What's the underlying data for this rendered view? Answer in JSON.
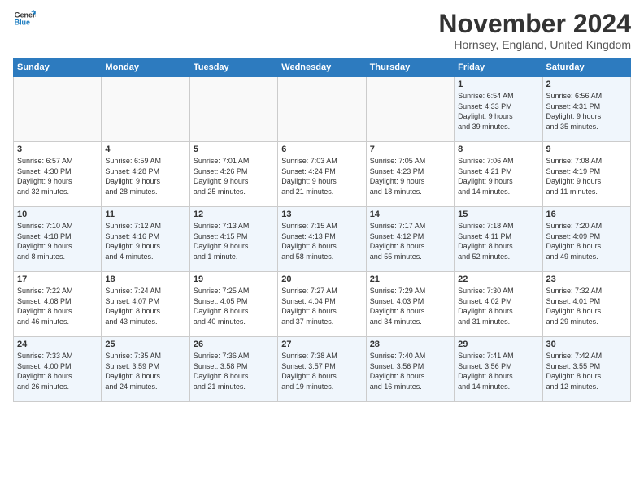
{
  "logo": {
    "text_general": "General",
    "text_blue": "Blue"
  },
  "title": "November 2024",
  "location": "Hornsey, England, United Kingdom",
  "headers": [
    "Sunday",
    "Monday",
    "Tuesday",
    "Wednesday",
    "Thursday",
    "Friday",
    "Saturday"
  ],
  "weeks": [
    [
      {
        "day": "",
        "info": ""
      },
      {
        "day": "",
        "info": ""
      },
      {
        "day": "",
        "info": ""
      },
      {
        "day": "",
        "info": ""
      },
      {
        "day": "",
        "info": ""
      },
      {
        "day": "1",
        "info": "Sunrise: 6:54 AM\nSunset: 4:33 PM\nDaylight: 9 hours\nand 39 minutes."
      },
      {
        "day": "2",
        "info": "Sunrise: 6:56 AM\nSunset: 4:31 PM\nDaylight: 9 hours\nand 35 minutes."
      }
    ],
    [
      {
        "day": "3",
        "info": "Sunrise: 6:57 AM\nSunset: 4:30 PM\nDaylight: 9 hours\nand 32 minutes."
      },
      {
        "day": "4",
        "info": "Sunrise: 6:59 AM\nSunset: 4:28 PM\nDaylight: 9 hours\nand 28 minutes."
      },
      {
        "day": "5",
        "info": "Sunrise: 7:01 AM\nSunset: 4:26 PM\nDaylight: 9 hours\nand 25 minutes."
      },
      {
        "day": "6",
        "info": "Sunrise: 7:03 AM\nSunset: 4:24 PM\nDaylight: 9 hours\nand 21 minutes."
      },
      {
        "day": "7",
        "info": "Sunrise: 7:05 AM\nSunset: 4:23 PM\nDaylight: 9 hours\nand 18 minutes."
      },
      {
        "day": "8",
        "info": "Sunrise: 7:06 AM\nSunset: 4:21 PM\nDaylight: 9 hours\nand 14 minutes."
      },
      {
        "day": "9",
        "info": "Sunrise: 7:08 AM\nSunset: 4:19 PM\nDaylight: 9 hours\nand 11 minutes."
      }
    ],
    [
      {
        "day": "10",
        "info": "Sunrise: 7:10 AM\nSunset: 4:18 PM\nDaylight: 9 hours\nand 8 minutes."
      },
      {
        "day": "11",
        "info": "Sunrise: 7:12 AM\nSunset: 4:16 PM\nDaylight: 9 hours\nand 4 minutes."
      },
      {
        "day": "12",
        "info": "Sunrise: 7:13 AM\nSunset: 4:15 PM\nDaylight: 9 hours\nand 1 minute."
      },
      {
        "day": "13",
        "info": "Sunrise: 7:15 AM\nSunset: 4:13 PM\nDaylight: 8 hours\nand 58 minutes."
      },
      {
        "day": "14",
        "info": "Sunrise: 7:17 AM\nSunset: 4:12 PM\nDaylight: 8 hours\nand 55 minutes."
      },
      {
        "day": "15",
        "info": "Sunrise: 7:18 AM\nSunset: 4:11 PM\nDaylight: 8 hours\nand 52 minutes."
      },
      {
        "day": "16",
        "info": "Sunrise: 7:20 AM\nSunset: 4:09 PM\nDaylight: 8 hours\nand 49 minutes."
      }
    ],
    [
      {
        "day": "17",
        "info": "Sunrise: 7:22 AM\nSunset: 4:08 PM\nDaylight: 8 hours\nand 46 minutes."
      },
      {
        "day": "18",
        "info": "Sunrise: 7:24 AM\nSunset: 4:07 PM\nDaylight: 8 hours\nand 43 minutes."
      },
      {
        "day": "19",
        "info": "Sunrise: 7:25 AM\nSunset: 4:05 PM\nDaylight: 8 hours\nand 40 minutes."
      },
      {
        "day": "20",
        "info": "Sunrise: 7:27 AM\nSunset: 4:04 PM\nDaylight: 8 hours\nand 37 minutes."
      },
      {
        "day": "21",
        "info": "Sunrise: 7:29 AM\nSunset: 4:03 PM\nDaylight: 8 hours\nand 34 minutes."
      },
      {
        "day": "22",
        "info": "Sunrise: 7:30 AM\nSunset: 4:02 PM\nDaylight: 8 hours\nand 31 minutes."
      },
      {
        "day": "23",
        "info": "Sunrise: 7:32 AM\nSunset: 4:01 PM\nDaylight: 8 hours\nand 29 minutes."
      }
    ],
    [
      {
        "day": "24",
        "info": "Sunrise: 7:33 AM\nSunset: 4:00 PM\nDaylight: 8 hours\nand 26 minutes."
      },
      {
        "day": "25",
        "info": "Sunrise: 7:35 AM\nSunset: 3:59 PM\nDaylight: 8 hours\nand 24 minutes."
      },
      {
        "day": "26",
        "info": "Sunrise: 7:36 AM\nSunset: 3:58 PM\nDaylight: 8 hours\nand 21 minutes."
      },
      {
        "day": "27",
        "info": "Sunrise: 7:38 AM\nSunset: 3:57 PM\nDaylight: 8 hours\nand 19 minutes."
      },
      {
        "day": "28",
        "info": "Sunrise: 7:40 AM\nSunset: 3:56 PM\nDaylight: 8 hours\nand 16 minutes."
      },
      {
        "day": "29",
        "info": "Sunrise: 7:41 AM\nSunset: 3:56 PM\nDaylight: 8 hours\nand 14 minutes."
      },
      {
        "day": "30",
        "info": "Sunrise: 7:42 AM\nSunset: 3:55 PM\nDaylight: 8 hours\nand 12 minutes."
      }
    ]
  ]
}
